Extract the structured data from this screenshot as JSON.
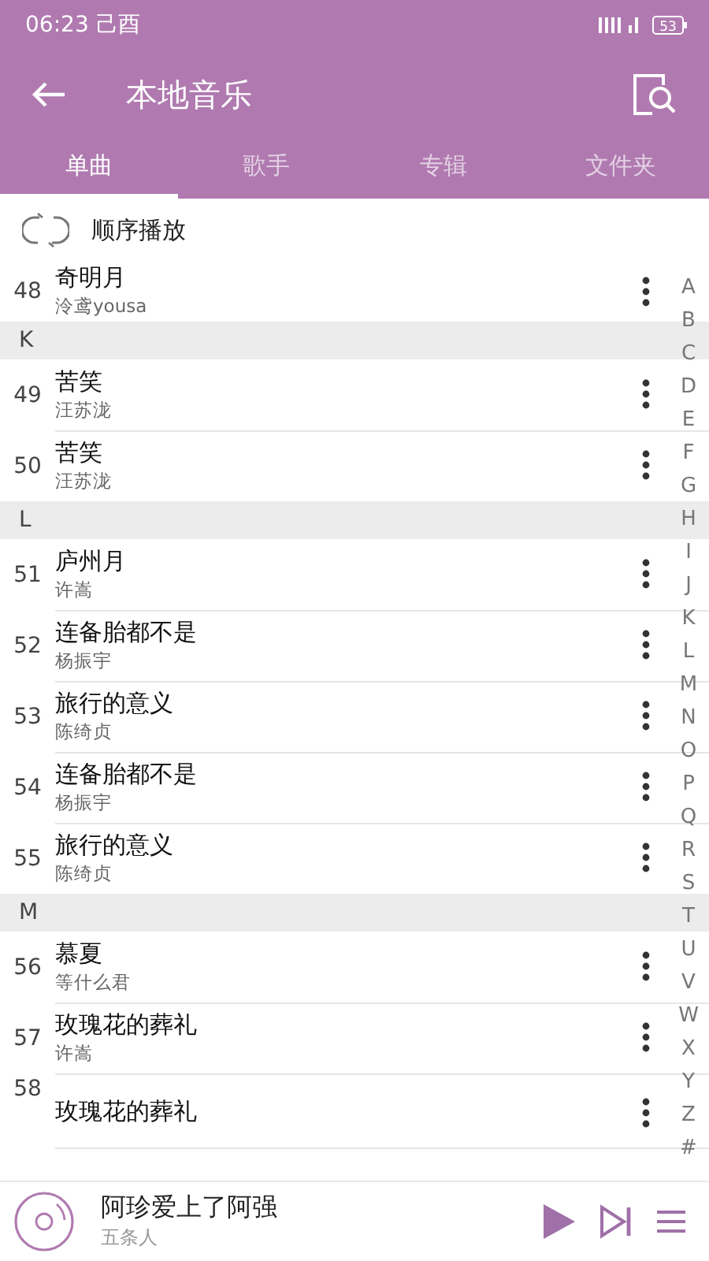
{
  "status_bar": {
    "time": "06:23 己酉",
    "battery": "53"
  },
  "header": {
    "title": "本地音乐"
  },
  "tabs": [
    {
      "label": "单曲",
      "selected": true
    },
    {
      "label": "歌手",
      "selected": false
    },
    {
      "label": "专辑",
      "selected": false
    },
    {
      "label": "文件夹",
      "selected": false
    }
  ],
  "play_mode": {
    "label": "顺序播放"
  },
  "list": [
    {
      "kind": "song",
      "number": "48",
      "title": "奇明月",
      "artist": "泠鸢yousa"
    },
    {
      "kind": "section",
      "label": "K"
    },
    {
      "kind": "song",
      "number": "49",
      "title": "苦笑",
      "artist": "汪苏泷"
    },
    {
      "kind": "song",
      "number": "50",
      "title": "苦笑",
      "artist": "汪苏泷"
    },
    {
      "kind": "section",
      "label": "L"
    },
    {
      "kind": "song",
      "number": "51",
      "title": "庐州月",
      "artist": "许嵩"
    },
    {
      "kind": "song",
      "number": "52",
      "title": "连备胎都不是",
      "artist": "杨振宇"
    },
    {
      "kind": "song",
      "number": "53",
      "title": "旅行的意义",
      "artist": "陈绮贞"
    },
    {
      "kind": "song",
      "number": "54",
      "title": "连备胎都不是",
      "artist": "杨振宇"
    },
    {
      "kind": "song",
      "number": "55",
      "title": "旅行的意义",
      "artist": "陈绮贞"
    },
    {
      "kind": "section",
      "label": "M"
    },
    {
      "kind": "song",
      "number": "56",
      "title": "慕夏",
      "artist": "等什么君"
    },
    {
      "kind": "song",
      "number": "57",
      "title": "玫瑰花的葬礼",
      "artist": "许嵩"
    },
    {
      "kind": "song",
      "number": "58",
      "title": "玫瑰花的葬礼"
    }
  ],
  "index": [
    "A",
    "B",
    "C",
    "D",
    "E",
    "F",
    "G",
    "H",
    "I",
    "J",
    "K",
    "L",
    "M",
    "N",
    "O",
    "P",
    "Q",
    "R",
    "S",
    "T",
    "U",
    "V",
    "W",
    "X",
    "Y",
    "Z",
    "#"
  ],
  "player": {
    "title": "阿珍爱上了阿强",
    "artist": "五条人"
  }
}
